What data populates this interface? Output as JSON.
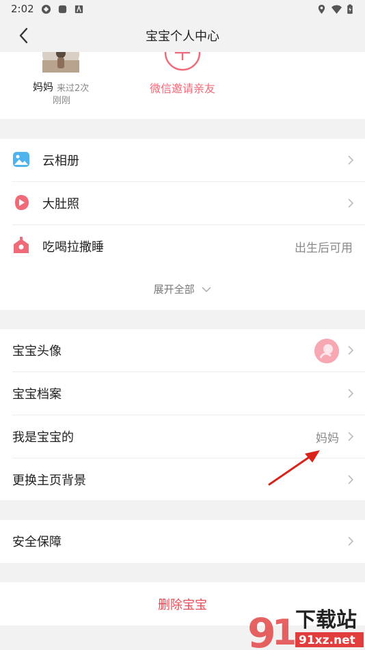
{
  "status_bar": {
    "time": "2:02"
  },
  "header": {
    "title": "宝宝个人中心"
  },
  "members": {
    "member_name": "妈妈",
    "member_visit": "来过2次",
    "member_time": "刚刚",
    "invite_label": "微信邀请亲友"
  },
  "features": {
    "items": [
      {
        "label": "云相册",
        "icon": "photo-album-icon"
      },
      {
        "label": "大肚照",
        "icon": "video-play-icon"
      },
      {
        "label": "吃喝拉撒睡",
        "icon": "house-icon",
        "value": "出生后可用"
      }
    ],
    "expand_label": "展开全部"
  },
  "settings": {
    "items": [
      {
        "label": "宝宝头像"
      },
      {
        "label": "宝宝档案"
      },
      {
        "label": "我是宝宝的",
        "value": "妈妈"
      },
      {
        "label": "更换主页背景"
      }
    ]
  },
  "safety": {
    "label": "安全保障"
  },
  "delete": {
    "label": "删除宝宝"
  },
  "watermark": {
    "text_cn": "下载站",
    "text_en": "91xz.net"
  },
  "colors": {
    "accent": "#f06b7a",
    "delete": "#e84a55",
    "background": "#f2f2f2"
  }
}
